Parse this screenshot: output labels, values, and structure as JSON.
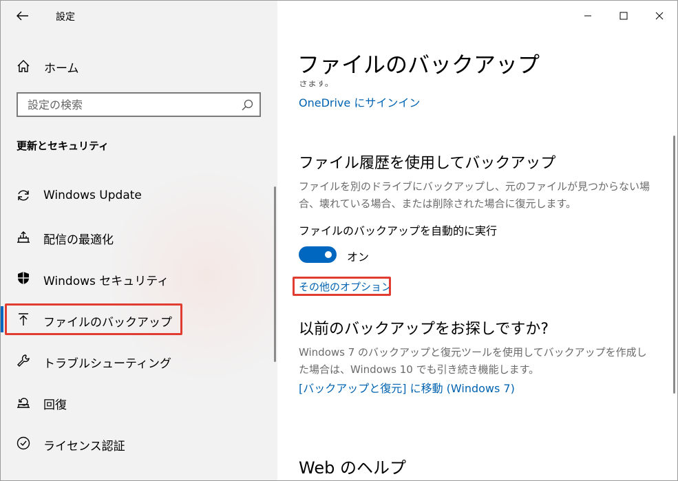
{
  "app": {
    "title": "設定"
  },
  "window_controls": [
    "minimize",
    "maximize",
    "close"
  ],
  "sidebar": {
    "home_label": "ホーム",
    "search_placeholder": "設定の検索",
    "section_title": "更新とセキュリティ",
    "items": [
      {
        "label": "Windows Update",
        "icon": "sync-icon"
      },
      {
        "label": "配信の最適化",
        "icon": "delivery-optimization-icon"
      },
      {
        "label": "Windows セキュリティ",
        "icon": "shield-icon"
      },
      {
        "label": "ファイルのバックアップ",
        "icon": "upload-arrow-icon",
        "selected": true
      },
      {
        "label": "トラブルシューティング",
        "icon": "wrench-icon"
      },
      {
        "label": "回復",
        "icon": "recovery-icon"
      },
      {
        "label": "ライセンス認証",
        "icon": "check-circle-icon"
      }
    ]
  },
  "main": {
    "page_title": "ファイルのバックアップ",
    "cut_off_text": "きます。",
    "onedrive_link": "OneDrive にサインイン",
    "file_history": {
      "heading": "ファイル履歴を使用してバックアップ",
      "description": "ファイルを別のドライブにバックアップし、元のファイルが見つからない場合、壊れている場合、または削除された場合に復元します。",
      "toggle_label": "ファイルのバックアップを自動的に実行",
      "toggle_state": "オン",
      "toggle_on": true,
      "more_options_link": "その他のオプション"
    },
    "older_backup": {
      "heading": "以前のバックアップをお探しですか?",
      "description": "Windows 7 のバックアップと復元ツールを使用してバックアップを作成した場合は、Windows 10 でも引き続き機能します。",
      "link": "[バックアップと復元] に移動 (Windows 7)"
    },
    "web_help": {
      "heading": "Web のヘルプ"
    }
  },
  "colors": {
    "accent": "#0067c0",
    "link": "#0063b1",
    "highlight": "#e03c31",
    "sidebar_bg": "#f2f2f2"
  }
}
